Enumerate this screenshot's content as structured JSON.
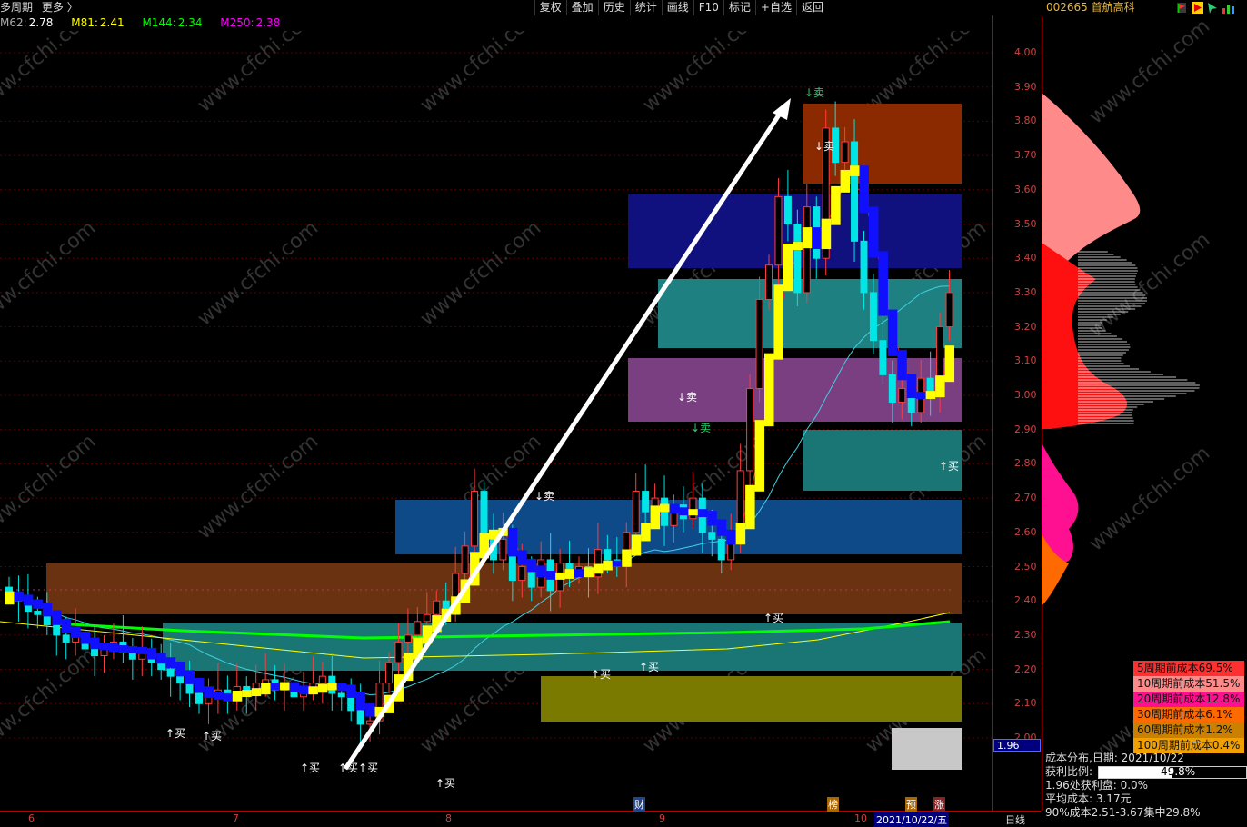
{
  "header": {
    "period": "多周期",
    "more": "更多",
    "more_arrow": "〉",
    "toolbar": [
      "复权",
      "叠加",
      "历史",
      "统计",
      "画线",
      "F10",
      "标记",
      "+自选",
      "返回"
    ],
    "stock_code": "002665",
    "stock_name": "首航高科"
  },
  "ma": [
    {
      "label": "M62:",
      "value": "2.78",
      "color": "#ffffff"
    },
    {
      "label": "M81:",
      "value": "2.41",
      "color": "#ffff00"
    },
    {
      "label": "M144:",
      "value": "2.34",
      "color": "#00ff00"
    },
    {
      "label": "M250:",
      "value": "2.38",
      "color": "#ff00ff"
    }
  ],
  "price_axis": [
    "4.00",
    "3.90",
    "3.80",
    "3.70",
    "3.60",
    "3.50",
    "3.40",
    "3.30",
    "3.20",
    "3.10",
    "3.00",
    "2.90",
    "2.80",
    "2.70",
    "2.60",
    "2.50",
    "2.40",
    "2.30",
    "2.20",
    "2.10",
    "2.00"
  ],
  "current_price": "1.96",
  "months": [
    "6",
    "7",
    "8",
    "9",
    "10"
  ],
  "date_label": "2021/10/22/五",
  "period_label": "日线",
  "chart_marks": {
    "buy": [
      "↑买",
      "↑买",
      "↑买",
      "↑买↑买",
      "↑买",
      "↑买",
      "↑买",
      "↑买",
      "↑买"
    ],
    "sell": [
      "↓卖",
      "↓卖",
      "↓卖",
      "↓卖",
      "↓卖"
    ],
    "events": [
      "财",
      "榜",
      "预",
      "涨"
    ]
  },
  "watermark": "www.cfchi.com",
  "cost_legend": [
    {
      "label": "5周期前成本69.5%",
      "color": "#ff3030"
    },
    {
      "label": "10周期前成本51.5%",
      "color": "#ff8a8a"
    },
    {
      "label": "20周期前成本12.8%",
      "color": "#ff1090"
    },
    {
      "label": "30周期前成本6.1%",
      "color": "#ff6a00"
    },
    {
      "label": "60周期前成本1.2%",
      "color": "#cc8000"
    },
    {
      "label": "100周期前成本0.4%",
      "color": "#f0a000"
    }
  ],
  "info": {
    "dist_date": "成本分布,日期:  2021/10/22",
    "profit_label": "获利比例:",
    "profit_value": "49.8%",
    "profit_fraction": 0.498,
    "profit_at": "1.96处获利盘:  0.0%",
    "avg_cost": "平均成本:  3.17元",
    "conc": "90%成本2.51-3.67集中29.8%"
  },
  "chart_data": {
    "type": "candlestick",
    "ylim": [
      2.0,
      4.0
    ],
    "moving_averages": [
      "M62",
      "M81",
      "M144",
      "M250"
    ],
    "last_close": 3.3,
    "high": 3.89,
    "low": 2.02
  }
}
